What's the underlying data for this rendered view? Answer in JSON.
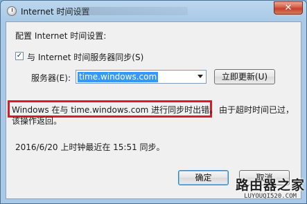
{
  "window": {
    "title": "Internet 时间设置",
    "close_label": "✕"
  },
  "content": {
    "heading": "配置 Internet 时间设置:",
    "sync_checkbox_label": "与 Internet 时间服务器同步(S)",
    "sync_checked": true,
    "server_label": "服务器(E):",
    "server_value": "time.windows.com",
    "update_button": "立即更新(U)",
    "error_highlighted": "Windows 在与 time.windows.com 进行同步时出错。",
    "error_rest_line1": "由于超时时间已过，",
    "error_rest_line2": "该操作返回。",
    "last_sync": "2016/6/20 上时钟最近在 15:51 同步。"
  },
  "buttons": {
    "ok": "确定",
    "cancel": "取消"
  },
  "watermark": {
    "title": "路由器之家",
    "url": "LUYOUQI520.COM"
  },
  "colors": {
    "highlight_border": "#d81b24",
    "selection": "#3399ff"
  }
}
